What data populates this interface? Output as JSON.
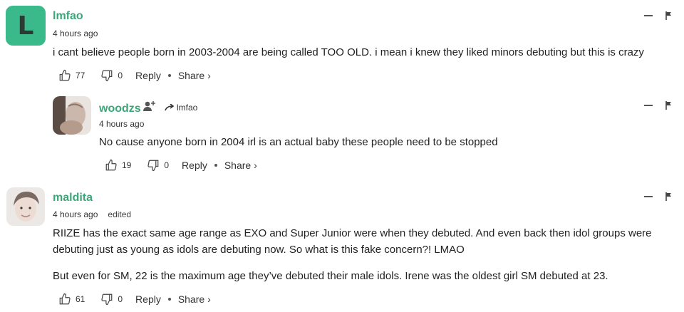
{
  "comments": [
    {
      "avatar_letter": "L",
      "avatar_color": "#3ab98a",
      "username": "lmfao",
      "time": "4 hours ago",
      "paragraphs": [
        "i cant believe people born in 2003-2004 are being called TOO OLD. i mean i knew they liked minors debuting but this is crazy"
      ],
      "likes": "77",
      "dislikes": "0",
      "reply_label": "Reply",
      "share_label": "Share ›"
    },
    {
      "username": "woodzs",
      "reply_to": "lmfao",
      "time": "4 hours ago",
      "paragraphs": [
        "No cause anyone born in 2004 irl is an actual baby these people need to be stopped"
      ],
      "likes": "19",
      "dislikes": "0",
      "reply_label": "Reply",
      "share_label": "Share ›"
    },
    {
      "username": "maldita",
      "time": "4 hours ago",
      "edited": "edited",
      "paragraphs": [
        "RIIZE has the exact same age range as EXO and Super Junior were when they debuted. And even back then idol groups were debuting just as young as idols are debuting now. So what is this fake concern?! LMAO",
        "But even for SM, 22 is the maximum age they’ve debuted their male idols. Irene was the oldest girl SM debuted at 23."
      ],
      "likes": "61",
      "dislikes": "0",
      "reply_label": "Reply",
      "share_label": "Share ›"
    }
  ],
  "colors": {
    "accent": "#3aa679",
    "avatar_green": "#3ab98a"
  }
}
